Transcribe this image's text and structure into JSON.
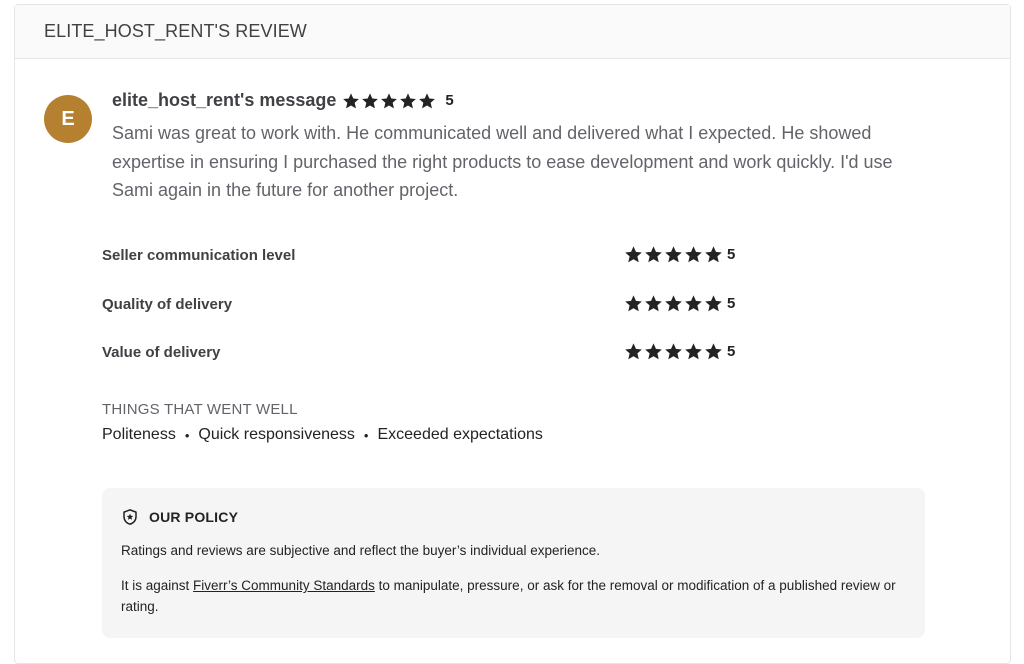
{
  "header": {
    "title": "ELITE_HOST_RENT'S REVIEW"
  },
  "message": {
    "avatar_initial": "E",
    "avatar_color": "#b5802f",
    "author": "elite_host_rent's message",
    "stars": 5,
    "score": "5",
    "text": "Sami was great to work with. He communicated well and delivered what I expected. He showed expertise in ensuring I purchased the right products to ease development and work quickly. I'd use Sami again in the future for another project."
  },
  "ratings": [
    {
      "label": "Seller communication level",
      "stars": 5,
      "score": "5"
    },
    {
      "label": "Quality of delivery",
      "stars": 5,
      "score": "5"
    },
    {
      "label": "Value of delivery",
      "stars": 5,
      "score": "5"
    }
  ],
  "went_well": {
    "title": "THINGS THAT WENT WELL",
    "tags": [
      "Politeness",
      "Quick responsiveness",
      "Exceeded expectations"
    ],
    "separator": "•"
  },
  "policy": {
    "icon": "shield-star-icon",
    "title": "OUR POLICY",
    "text1": "Ratings and reviews are subjective and reflect the buyer’s individual experience.",
    "text2_before": "It is against ",
    "text2_link": "Fiverr’s Community Standards",
    "text2_after": " to manipulate, pressure, or ask for the removal or modification of a published review or rating."
  },
  "colors": {
    "star": "#222325",
    "text": "#404145",
    "muted": "#62646a",
    "policy_bg": "#f5f5f5"
  }
}
